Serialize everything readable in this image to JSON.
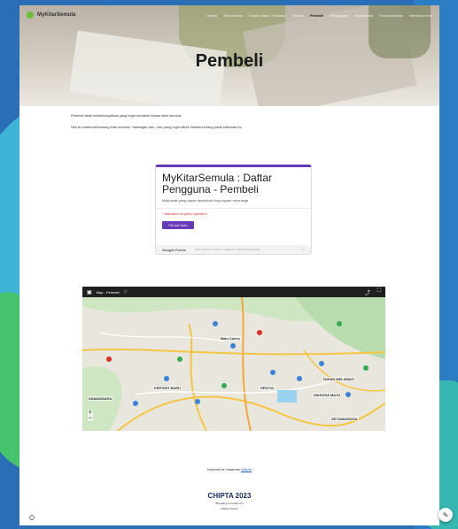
{
  "site": {
    "brand": "MyKitarSemula",
    "nav_items": [
      "Utama",
      "Jenis Bahan",
      "Semak Jalan / Tawaran",
      "Penjual",
      "Pembeli",
      "Pengangkut",
      "Komunikasi",
      "Documentation",
      "Members area"
    ],
    "active_nav": "Pembeli"
  },
  "hero": {
    "title": "Pembeli"
  },
  "content": {
    "para1": "Pembeli ialah individu/syarikat yang ingin membeli bahan kitar semula.",
    "para2": "Sila isi maklumat barang kitar semula / barangan lain - lain yang ingin dibeli melalui borang pada halaman ini."
  },
  "form": {
    "title": "MyKitarSemula : Daftar Pengguna - Pembeli",
    "description": "Maklumat yang dapat diperlukan bagi tujuan urusniaga",
    "required_note": "* Indicates required question",
    "button": "Fill out form",
    "footer_brand": "Google Forms",
    "footer_note": "This content is neither created nor endorsed by Google."
  },
  "map": {
    "title": "Map - Pembeli",
    "labels": [
      "Batu Caves",
      "KEPONG BARU",
      "SENTUL",
      "WANGSA MAJU",
      "TAMAN MELAWATI",
      "SETIAWANGSA",
      "DAMANSARA"
    ]
  },
  "footer": {
    "back_prefix": "Kembali ke Halaman ",
    "back_link": "Utama",
    "event_name": "CHIPTA 2023",
    "event_tag1": "\"Boosting Innovation for",
    "event_tag2": "a Better Future\""
  },
  "icons": {
    "edit": "pencil-icon",
    "info": "info-icon"
  }
}
